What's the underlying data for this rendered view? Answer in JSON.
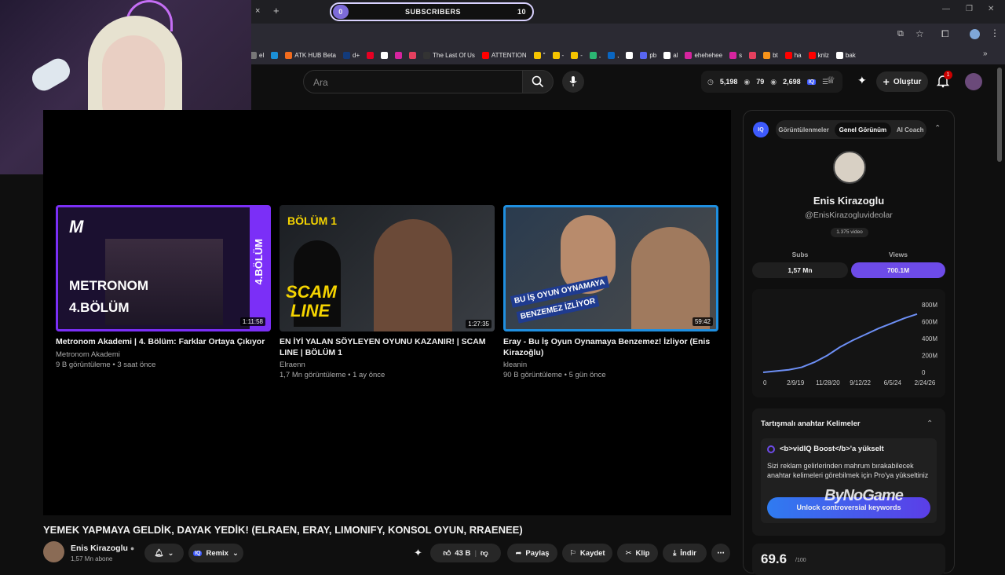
{
  "browser": {
    "subscribers_label": "SUBSCRIBERS",
    "subscribers_start": "0",
    "subscribers_goal": "10",
    "new_tab": "+",
    "close_tab": "×",
    "bookmarks": [
      {
        "label": "el",
        "color": "#777777"
      },
      {
        "label": "",
        "color": "#1b8fd6"
      },
      {
        "label": "ATK HUB Beta",
        "color": "#f26b1d"
      },
      {
        "label": "d+",
        "color": "#123a7a"
      },
      {
        "label": "",
        "color": "#e60023"
      },
      {
        "label": "",
        "color": "#ffffff"
      },
      {
        "label": "",
        "color": "#d6249f"
      },
      {
        "label": "",
        "color": "#e4405f"
      },
      {
        "label": "The Last Of Us",
        "color": "#333333"
      },
      {
        "label": "ATTENTION",
        "color": "#ff0000"
      },
      {
        "label": "\"",
        "color": "#f5c400"
      },
      {
        "label": "-",
        "color": "#f5c400"
      },
      {
        "label": "-",
        "color": "#f5c400"
      },
      {
        "label": ",",
        "color": "#2bb673"
      },
      {
        "label": ",",
        "color": "#0a66c2"
      },
      {
        "label": "",
        "color": "#ffffff"
      },
      {
        "label": "pb",
        "color": "#5865f2"
      },
      {
        "label": "al",
        "color": "#ffffff"
      },
      {
        "label": "ehehehee",
        "color": "#d6249f"
      },
      {
        "label": "s",
        "color": "#d6249f"
      },
      {
        "label": "",
        "color": "#e4405f"
      },
      {
        "label": "bt",
        "color": "#f7931a"
      },
      {
        "label": "ha",
        "color": "#ff0000"
      },
      {
        "label": "knlz",
        "color": "#ff0000"
      },
      {
        "label": "bak",
        "color": "#ffffff"
      }
    ]
  },
  "header": {
    "search_placeholder": "Ara",
    "stats": {
      "a": "5,198",
      "b": "79",
      "c": "2,698"
    },
    "create_label": "Oluştur",
    "notif_count": "1"
  },
  "cards": [
    {
      "title": "Metronom Akademi | 4. Bölüm: Farklar Ortaya Çıkıyor",
      "channel": "Metronom Akademi",
      "meta": "9 B görüntüleme • 3 saat önce",
      "duration": "1:11:58",
      "thumb_text_1": "METRONOM",
      "thumb_text_2": "4.BÖLÜM",
      "thumb_side": "4.BÖLÜM",
      "thumb_logo": "M",
      "accent": "#7b2ff7"
    },
    {
      "title": "EN İYİ YALAN SÖYLEYEN OYUNU KAZANIR! | SCAM LINE | BÖLÜM 1",
      "channel": "Elraenn",
      "meta": "1,7 Mn görüntüleme • 1 ay önce",
      "duration": "1:27:35",
      "thumb_text_1": "BÖLÜM 1",
      "thumb_text_2": "SCAM",
      "thumb_text_3": "LINE",
      "accent": "#f5d400"
    },
    {
      "title": "Eray - Bu İş Oyun Oynamaya Benzemez! İzliyor (Enis Kirazoğlu)",
      "channel": "kleanin",
      "meta": "90 B görüntüleme • 5 gün önce",
      "duration": "59:42",
      "thumb_text_1": "BU İŞ OYUN OYNAMAYA",
      "thumb_text_2": "BENZEMEZ İZLİYOR",
      "accent": "#1f8fe0"
    }
  ],
  "video": {
    "title": "YEMEK YAPMAYA GELDİK, DAYAK YEDİK! (ELRAEN, ERAY, LIMONIFY, KONSOL OYUN, RRAENEE)",
    "channel": "Enis Kirazoglu",
    "subs": "1,57 Mn abone",
    "remix": "Remix",
    "likes": "43 B",
    "share": "Paylaş",
    "save": "Kaydet",
    "clip": "Klip",
    "download": "İndir"
  },
  "vidiq": {
    "logo": "IQ",
    "tabs": [
      "Görüntülenmeler",
      "Genel Görünüm",
      "AI Coach"
    ],
    "active_tab": "Genel Görünüm",
    "name": "Enis Kirazoglu",
    "handle": "@EnisKirazogluvideolar",
    "video_count": "1.375 video",
    "subs_label": "Subs",
    "views_label": "Views",
    "subs_value": "1,57 Mn",
    "views_value": "700.1M",
    "keywords_title": "Tartışmalı anahtar Kelimeler",
    "boost": "<b>vidIQ Boost</b>'a yükselt",
    "boost_desc": "Sizi reklam gelirlerinden mahrum bırakabilecek anahtar kelimeleri görebilmek için Pro'ya yükseltiniz",
    "unlock": "Unlock controversial keywords",
    "score": "69.6",
    "score_of": "/100"
  },
  "watermark": "ByNoGame",
  "chart_data": {
    "type": "area",
    "x": [
      "0",
      "2/9/19",
      "11/28/20",
      "9/12/22",
      "6/5/24",
      "2/24/26"
    ],
    "y_ticks": [
      "0",
      "200M",
      "400M",
      "600M",
      "800M"
    ],
    "series": [
      {
        "values": [
          0,
          15,
          30,
          60,
          120,
          200,
          300,
          380,
          450,
          520,
          580,
          640,
          690
        ]
      }
    ],
    "ylim": [
      0,
      800
    ],
    "color": "#6d8ff5"
  }
}
